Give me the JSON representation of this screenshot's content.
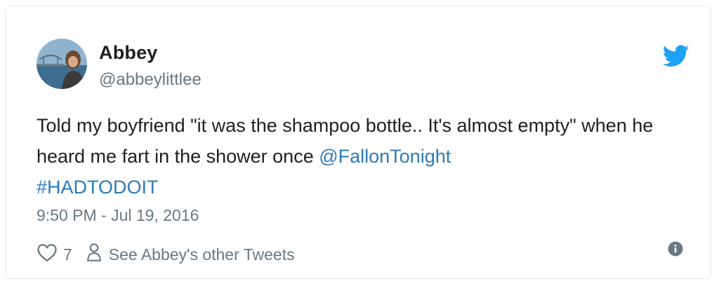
{
  "tweet": {
    "author_name": "Abbey",
    "author_handle": "@abbeylittlee",
    "text_plain": "Told my boyfriend \"it was the shampoo bottle.. It's almost empty\" when he heard me fart in the shower once ",
    "mention": "@FallonTonight",
    "hashtag": "#HADTODOIT",
    "timestamp": "9:50 PM - Jul 19, 2016",
    "like_count": "7",
    "other_tweets_label": "See Abbey's other Tweets"
  },
  "icons": {
    "brand": "twitter-bird-icon",
    "like": "heart-icon",
    "person": "person-icon",
    "info": "info-icon"
  },
  "colors": {
    "link": "#2b7bb9",
    "brand": "#1da1f2",
    "muted": "#697882",
    "text": "#1c2022"
  }
}
